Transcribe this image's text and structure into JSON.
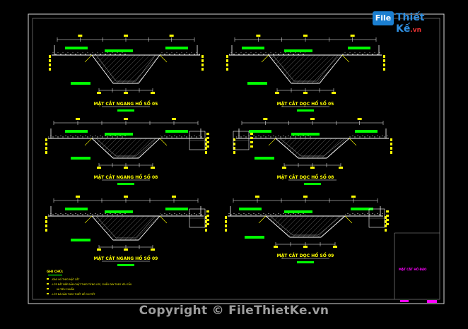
{
  "logo": {
    "badge": "File",
    "text": "Thiết Kế",
    "suffix": ".vn"
  },
  "watermark": "Copyright © FileThietKe.vn",
  "sections": {
    "s1_left": "MẶT CẮT NGANG HỐ SỐ 05",
    "s1_right": "MẶT CẮT DỌC HỐ SỐ 05",
    "s2_left": "MẶT CẮT NGANG HỐ SỐ 08",
    "s2_right": "MẶT CẮT DỌC HỐ SỐ 08",
    "s3_left": "MẶT CẮT NGANG HỐ SỐ 09",
    "s3_right": "MẶT CẮT DỌC HỐ SỐ 09"
  },
  "notes": {
    "title": "GHI CHÚ:",
    "lines": [
      "- ĐÀO HỐ THEO MẶT CẮT",
      "- LỚP ĐẤT ĐẮP ĐẦM CHẶT THEO TỪNG LỚP, CHIỀU DÀY THEO YÊU CẦU",
      "VÀ TIÊU CHUẨN",
      "- LỚP ĐÁ DĂM THEO THIẾT KẾ CHI TIẾT"
    ]
  },
  "title_block": {
    "label": "MẶT CẮT HỐ ĐÀO"
  },
  "colors": {
    "line": "#ffffff",
    "dim": "#00ff00",
    "label": "#ffff00",
    "accent": "#ff00ff",
    "frame": "#cfcfcf"
  }
}
